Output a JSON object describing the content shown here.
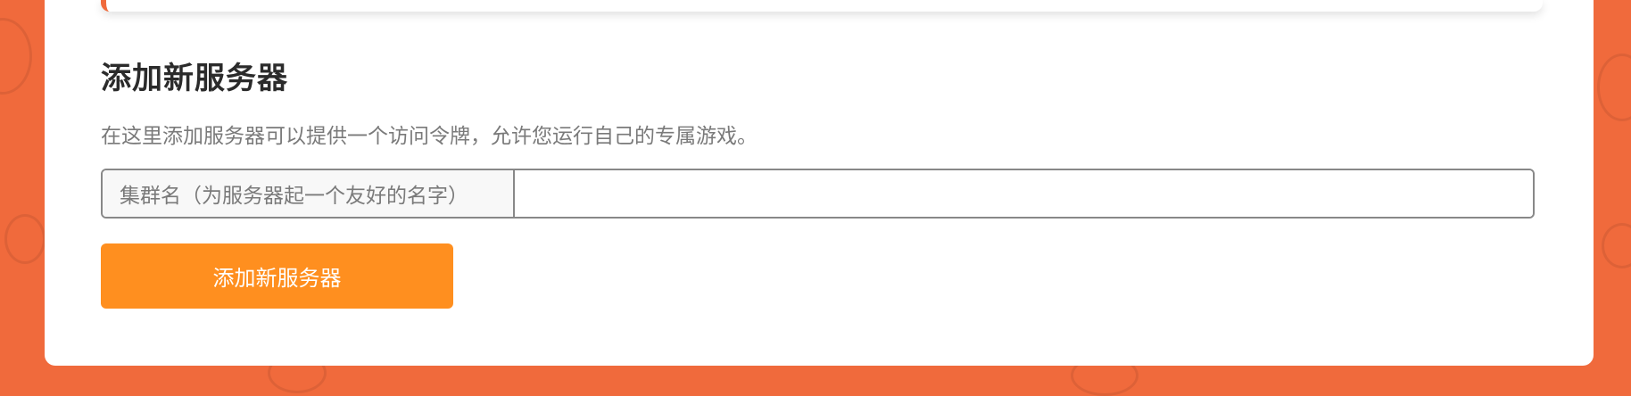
{
  "add_server": {
    "title": "添加新服务器",
    "description": "在这里添加服务器可以提供一个访问令牌，允许您运行自己的专属游戏。",
    "cluster_name_label": "集群名（为服务器起一个友好的名字）",
    "cluster_name_value": "",
    "submit_label": "添加新服务器"
  },
  "colors": {
    "background": "#f06a3c",
    "button": "#ff8f1f",
    "panel": "#ffffff"
  }
}
